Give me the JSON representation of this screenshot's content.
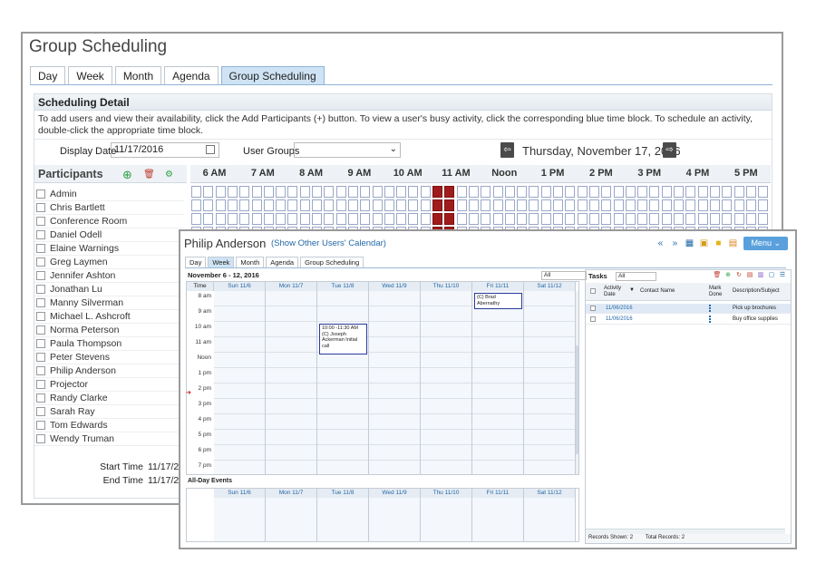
{
  "group_scheduling": {
    "title": "Group Scheduling",
    "tabs": [
      "Day",
      "Week",
      "Month",
      "Agenda",
      "Group Scheduling"
    ],
    "active_tab": "Group Scheduling",
    "detail_title": "Scheduling Detail",
    "help_text": "To add users and view their availability, click the Add Participants (+) button. To view a user's busy activity, click the corresponding blue time block. To schedule an activity, double-click the appropriate time block.",
    "display_date_label": "Display Date",
    "display_date_value": "11/17/2016",
    "user_groups_label": "User Groups",
    "user_groups_value": "",
    "current_date": "Thursday, November 17, 2016",
    "participants_title": "Participants",
    "participants": [
      "Admin",
      "Chris Bartlett",
      "Conference Room",
      "Daniel Odell",
      "Elaine Warnings",
      "Greg Laymen",
      "Jennifer Ashton",
      "Jonathan Lu",
      "Manny Silverman",
      "Michael L. Ashcroft",
      "Norma Peterson",
      "Paula Thompson",
      "Peter Stevens",
      "Philip Anderson",
      "Projector",
      "Randy Clarke",
      "Sarah Ray",
      "Tom Edwards",
      "Wendy Truman"
    ],
    "start_time_label": "Start Time",
    "start_time_value": "11/17/2",
    "end_time_label": "End Time",
    "end_time_value": "11/17/2",
    "hours": [
      "6 AM",
      "7 AM",
      "8 AM",
      "9 AM",
      "10 AM",
      "11 AM",
      "Noon",
      "1 PM",
      "2 PM",
      "3 PM",
      "4 PM",
      "5 PM"
    ],
    "busy_color": "#a01c1c"
  },
  "user_calendar": {
    "user_name": "Philip Anderson",
    "other_users_link": "(Show Other Users' Calendar)",
    "menu_label": "Menu",
    "tabs": [
      "Day",
      "Week",
      "Month",
      "Agenda",
      "Group Scheduling"
    ],
    "active_tab": "Week",
    "week_range": "November 6 - 12, 2016",
    "filter_value": "All",
    "time_header": "Time",
    "days": [
      "Sun 11/6",
      "Mon 11/7",
      "Tue 11/8",
      "Wed 11/9",
      "Thu 11/10",
      "Fri 11/11",
      "Sat 11/12"
    ],
    "hour_labels": [
      "8 am",
      "9 am",
      "10 am",
      "11 am",
      "Noon",
      "1 pm",
      "2 pm",
      "3 pm",
      "4 pm",
      "5 pm",
      "6 pm",
      "7 pm"
    ],
    "events": [
      {
        "day": 5,
        "text": "(C)  Brad Abernathy"
      },
      {
        "day": 2,
        "text": "10:00 -11:30 AM (C)  Joseph Ackerman Initial call"
      }
    ],
    "all_day_label": "All-Day Events",
    "tasks": {
      "title": "Tasks",
      "filter": "All",
      "col_activity_date": "Activity Date",
      "col_contact": "Contact Name",
      "col_mark_done": "Mark Done",
      "col_description": "Description/Subject",
      "rows": [
        {
          "date": "11/06/2016",
          "description": "Pick up brochures"
        },
        {
          "date": "11/06/2016",
          "description": "Buy office supplies"
        }
      ],
      "records_shown": "Records Shown: 2",
      "total_records": "Total Records: 2"
    }
  }
}
